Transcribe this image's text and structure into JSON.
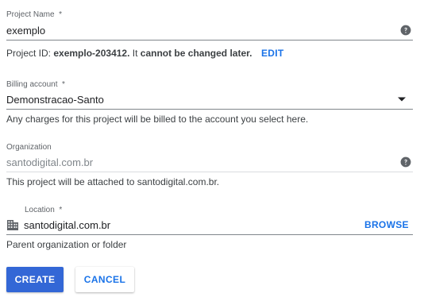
{
  "project_name": {
    "label": "Project Name",
    "required_mark": "*",
    "value": "exemplo",
    "help_icon": "help-circle-icon"
  },
  "project_id_hint": {
    "prefix": "Project ID: ",
    "id": "exemplo-203412.",
    "middle": " It ",
    "emphasis": "cannot be changed later.",
    "edit_label": "EDIT"
  },
  "billing": {
    "label": "Billing account",
    "required_mark": "*",
    "value": "Demonstracao-Santo",
    "dropdown_icon": "dropdown-arrow-icon",
    "hint": "Any charges for this project will be billed to the account you select here."
  },
  "organization": {
    "label": "Organization",
    "value": "santodigital.com.br",
    "help_icon": "help-circle-icon",
    "hint": "This project will be attached to santodigital.com.br."
  },
  "location": {
    "label": "Location",
    "required_mark": "*",
    "value": "santodigital.com.br",
    "icon": "building-icon",
    "browse_label": "BROWSE",
    "hint": "Parent organization or folder"
  },
  "actions": {
    "create_label": "CREATE",
    "cancel_label": "CANCEL"
  },
  "colors": {
    "accent": "#1a73e8",
    "primary_button": "#3367d6",
    "label_gray": "#5f6368",
    "text": "#202124"
  }
}
